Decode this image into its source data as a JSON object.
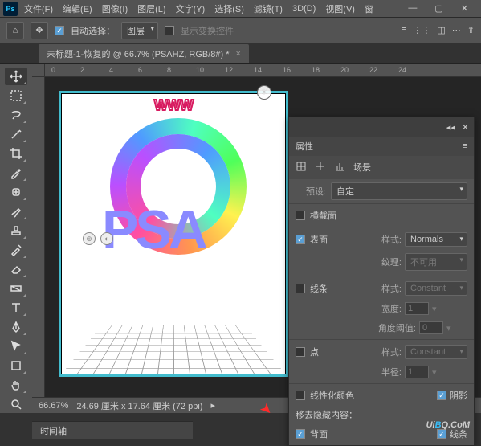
{
  "menu": {
    "file": "文件(F)",
    "edit": "编辑(E)",
    "image": "图像(I)",
    "layer": "图层(L)",
    "type": "文字(Y)",
    "select": "选择(S)",
    "filter": "滤镜(T)",
    "threeD": "3D(D)",
    "view": "视图(V)",
    "window": "窗"
  },
  "options": {
    "autoSelect": "自动选择：",
    "target": "图层",
    "showTransform": "显示变换控件"
  },
  "tab": {
    "title": "未标题-1-恢复的 @ 66.7% (PSAHZ, RGB/8#) *"
  },
  "ruler": {
    "marks": [
      "0",
      "2",
      "4",
      "6",
      "8",
      "10",
      "12",
      "14",
      "16",
      "18",
      "20",
      "22",
      "24"
    ]
  },
  "canvas": {
    "watermark": "WWW",
    "bigText": "PSA"
  },
  "status": {
    "zoom": "66.67%",
    "dims": "24.69 厘米 x 17.64 厘米 (72 ppi)"
  },
  "timeline": {
    "label": "时间轴"
  },
  "panel": {
    "title": "属性",
    "scene": "场景",
    "presetLbl": "预设:",
    "preset": "自定",
    "crossSection": "横截面",
    "surface": "表面",
    "styleLbl": "样式:",
    "styleSurface": "Normals",
    "textureLbl": "纹理:",
    "texture": "不可用",
    "lines": "线条",
    "styleLines": "Constant",
    "widthLbl": "宽度:",
    "width": "1",
    "angleLbl": "角度阈值:",
    "angle": "0",
    "points": "点",
    "stylePoints": "Constant",
    "radiusLbl": "半径:",
    "radius": "1",
    "linearize": "线性化颜色",
    "shadow": "阴影",
    "removeHidden": "移去隐藏内容：",
    "backface": "背面",
    "lines2": "线条"
  },
  "brand": {
    "a": "Ui",
    "b": "B",
    "c": "Q.CoM"
  }
}
